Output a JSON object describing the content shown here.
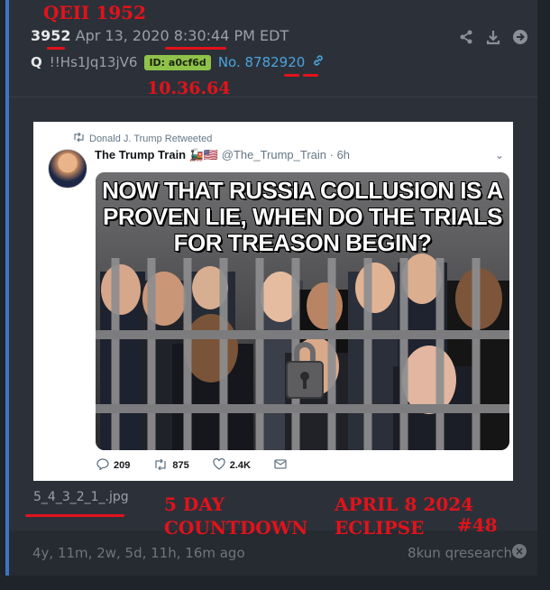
{
  "annotations": {
    "qeii": "QEII 1952",
    "time_code": "10.36.64",
    "countdown_line1": "5 DAY",
    "countdown_line2": "COUNTDOWN",
    "eclipse_line1": "APRIL 8  2024",
    "eclipse_line2": "ECLIPSE",
    "drop_number": "#48",
    "color": "#e3121a"
  },
  "post": {
    "number": "3952",
    "date": "Apr 13, 2020 8:30:44 PM EDT",
    "author": "Q",
    "tripcode": "!!Hs1Jq13jV6",
    "id_badge": "ID: a0cf6d",
    "post_no": "No. 8782920",
    "filename": "5_4_3_2_1_.jpg",
    "age": "4y, 11m, 2w, 5d, 11h, 16m ago",
    "board": "8kun qresearch"
  },
  "icons": [
    "share-icon",
    "download-icon",
    "arrow-right-circle-icon",
    "link-icon",
    "close-circle-icon"
  ],
  "tweet": {
    "retweeted_by": "Donald J. Trump Retweeted",
    "display_name": "The Trump Train",
    "handle_time": "@The_Trump_Train · 6h",
    "meme_line1": "NOW THAT RUSSIA COLLUSION IS A",
    "meme_line2": "PROVEN LIE, WHEN DO THE TRIALS",
    "meme_line3": "FOR TREASON BEGIN?",
    "replies": "209",
    "retweets": "875",
    "likes": "2.4K"
  },
  "colors": {
    "accent": "#3b76c5",
    "id_badge": "#8fc24a",
    "post_link": "#4aa3df"
  }
}
